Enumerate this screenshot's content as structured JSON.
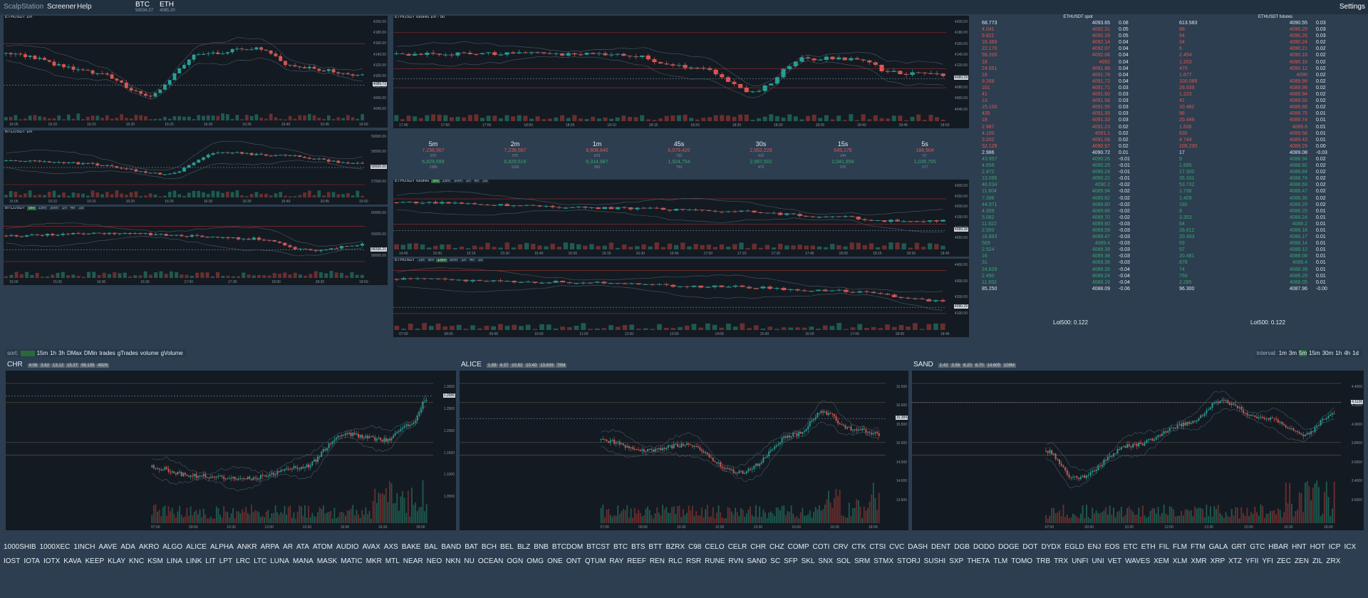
{
  "app": {
    "brand": "ScalpStation",
    "menu": [
      "Screener",
      "Help"
    ],
    "settings": "Settings"
  },
  "tickers": [
    {
      "sym": "BTC",
      "price": "58534.37"
    },
    {
      "sym": "ETH",
      "price": "4085.20"
    }
  ],
  "charts": {
    "btc1m": {
      "title": "ETHUSDT 1m",
      "y": [
        "4200.00",
        "4180.00",
        "4160.00",
        "4140.00",
        "4120.00",
        "4100.00",
        "4080.00",
        "4060.00",
        "4040.00"
      ],
      "x": [
        "16:05",
        "16:10",
        "16:15",
        "16:20",
        "16:25",
        "16:30",
        "16:35",
        "16:40",
        "16:45",
        "16:50"
      ],
      "curr": "4089.73"
    },
    "btc1m2": {
      "title": "BTCUSDT 1m",
      "y": [
        "59000.00",
        "58500.00",
        "58000.00",
        "57500.00"
      ],
      "x": [
        "16:05",
        "16:10",
        "16:15",
        "16:20",
        "16:25",
        "16:30",
        "16:35",
        "16:40",
        "16:45",
        "16:50"
      ],
      "curr": "58500.00"
    },
    "btc5m": {
      "title": "BTCUSDT",
      "buttons": [
        "5m",
        "15m",
        "30m",
        "1h",
        "4h",
        "1d"
      ],
      "active": "5m",
      "y": [
        "60000.00",
        "59000.00",
        "58000.00"
      ],
      "x": [
        "15:00",
        "15:30",
        "16:00",
        "16:30",
        "17:00",
        "17:30",
        "18:00",
        "18:30",
        "18:50"
      ],
      "curr": "58336.21"
    },
    "ethfut1m": {
      "title": "ETHUSDT futures 1m - 50",
      "y": [
        "4200.00",
        "4180.00",
        "4160.00",
        "4140.00",
        "4120.00",
        "4100.00",
        "4080.00",
        "4060.00",
        "4040.00"
      ],
      "x": [
        "17:45",
        "17:50",
        "17:55",
        "18:00",
        "18:05",
        "18:10",
        "18:15",
        "18:20",
        "18:25",
        "18:30",
        "18:35",
        "18:40",
        "18:45",
        "18:50"
      ],
      "curr": "4089.29"
    },
    "ethfut5m": {
      "title": "ETHUSDT futures",
      "buttons": [
        "5m",
        "15m",
        "30m",
        "1h",
        "4h",
        "1d"
      ],
      "active": "5m",
      "y": [
        "4300.00",
        "4250.00",
        "4200.00",
        "4150.00",
        "4100.00",
        "4050.00"
      ],
      "x": [
        "14:45",
        "15:00",
        "15:15",
        "15:30",
        "15:45",
        "16:00",
        "16:15",
        "16:30",
        "16:45",
        "17:00",
        "17:15",
        "17:30",
        "17:45",
        "18:00",
        "18:15",
        "18:30",
        "18:45"
      ],
      "curr": "4089.28"
    },
    "eth1h": {
      "title": "ETHUSDT",
      "buttons": [
        "1m",
        "5m",
        "15m",
        "30m",
        "1h",
        "4h",
        "1d"
      ],
      "active": "15m",
      "y": [
        "4400.00",
        "4300.00",
        "4200.00",
        "4100.00"
      ],
      "x": [
        "07:00",
        "08:00",
        "09:00",
        "10:00",
        "11:00",
        "12:00",
        "13:00",
        "14:00",
        "15:00",
        "16:00",
        "17:00",
        "18:00",
        "18:45"
      ],
      "curr": "4090.29"
    }
  },
  "timeframes": [
    {
      "h": "5m",
      "r": "7,238,567",
      "s1": "975",
      "g": "6,829,599",
      "s2": "1385"
    },
    {
      "h": "2m",
      "r": "7,238,567",
      "s1": "975",
      "g": "6,829,516",
      "s2": "1100"
    },
    {
      "h": "1m",
      "r": "8,608,840",
      "s1": "879",
      "g": "6,314,987",
      "s2": "583"
    },
    {
      "h": "45s",
      "r": "6,079,420",
      "s1": "720",
      "g": "1,924,754",
      "s2": "753"
    },
    {
      "h": "30s",
      "r": "2,552,228",
      "s1": "410",
      "g": "2,987,502",
      "s2": "475"
    },
    {
      "h": "15s",
      "r": "545,176",
      "s1": "144",
      "g": "2,041,858",
      "s2": "375"
    },
    {
      "h": "5s",
      "r": "188,904",
      "s1": "57",
      "g": "1,039,755",
      "s2": "177"
    }
  ],
  "orderbook": {
    "spot_title": "ETHUSDT spot",
    "fut_title": "ETHUSDT futures",
    "rows": [
      [
        "68.773",
        "4093.65",
        "0.08",
        "613.583",
        "4090.55",
        "0.03",
        "w"
      ],
      [
        "4.041",
        "4092.31",
        "0.05",
        "88",
        "4090.29",
        "0.03",
        "r"
      ],
      [
        "9.821",
        "4092.19",
        "0.05",
        "94",
        "4090.26",
        "0.03",
        "r"
      ],
      [
        "16.369",
        "4092.14",
        "0.04",
        "34",
        "4090.24",
        "0.02",
        "r"
      ],
      [
        "22.170",
        "4092.07",
        "0.04",
        "6",
        "4090.21",
        "0.02",
        "r"
      ],
      [
        "59.205",
        "4092.06",
        "0.04",
        "2.454",
        "4090.18",
        "0.02",
        "r"
      ],
      [
        "18",
        "4092",
        "0.04",
        "1.203",
        "4090.16",
        "0.02",
        "r"
      ],
      [
        "24.551",
        "4091.88",
        "0.04",
        "470",
        "4090.12",
        "0.02",
        "r"
      ],
      [
        "18",
        "4091.78",
        "0.04",
        "1.677",
        "4090",
        "0.02",
        "r"
      ],
      [
        "9.268",
        "4091.72",
        "0.04",
        "100.089",
        "4089.99",
        "0.02",
        "r"
      ],
      [
        "101",
        "4091.71",
        "0.03",
        "29.939",
        "4089.98",
        "0.02",
        "r"
      ],
      [
        "41",
        "4091.60",
        "0.03",
        "1.223",
        "4089.94",
        "0.02",
        "r"
      ],
      [
        "13",
        "4091.58",
        "0.03",
        "41",
        "4089.92",
        "0.02",
        "r"
      ],
      [
        "15.100",
        "4091.55",
        "0.03",
        "10.482",
        "4089.88",
        "0.02",
        "r"
      ],
      [
        "435",
        "4091.35",
        "0.03",
        "96",
        "4089.75",
        "0.01",
        "r"
      ],
      [
        "18",
        "4091.33",
        "0.03",
        "20.449",
        "4089.74",
        "0.01",
        "r"
      ],
      [
        "2.987",
        "4091.23",
        "0.02",
        "1.636",
        "4089.6",
        "0.01",
        "r"
      ],
      [
        "4.100",
        "4091.1",
        "0.02",
        "630",
        "4089.58",
        "0.01",
        "r"
      ],
      [
        "3.202",
        "4091.08",
        "0.02",
        "4.744",
        "4089.43",
        "0.01",
        "r"
      ],
      [
        "32.128",
        "4090.97",
        "0.02",
        "105.230",
        "4089.29",
        "0.00",
        "r"
      ],
      [
        "2.986",
        "4090.72",
        "0.01",
        "17",
        "4089.08",
        "-0.03",
        "w"
      ],
      [
        "43.957",
        "4090.26",
        "-0.01",
        "9",
        "4088.94",
        "0.02",
        "g"
      ],
      [
        "4.658",
        "4090.25",
        "-0.01",
        "1.895",
        "4088.92",
        "0.02",
        "g"
      ],
      [
        "2.472",
        "4090.24",
        "-0.01",
        "17.300",
        "4088.84",
        "0.02",
        "g"
      ],
      [
        "13.085",
        "4090.22",
        "-0.01",
        "35.331",
        "4088.74",
        "0.02",
        "g"
      ],
      [
        "46.034",
        "4090.2",
        "-0.02",
        "53.732",
        "4088.69",
        "0.02",
        "g"
      ],
      [
        "11.604",
        "4089.94",
        "-0.02",
        "1.736",
        "4088.47",
        "0.02",
        "g"
      ],
      [
        "7.396",
        "4089.82",
        "-0.02",
        "1.409",
        "4088.36",
        "0.02",
        "g"
      ],
      [
        "44.971",
        "4089.80",
        "-0.02",
        "180",
        "4088.29",
        "0.02",
        "g"
      ],
      [
        "4.309",
        "4089.68",
        "-0.02",
        "8",
        "4088.25",
        "0.01",
        "g"
      ],
      [
        "5.082",
        "4089.70",
        "-0.02",
        "3.353",
        "4088.24",
        "0.01",
        "g"
      ],
      [
        "11.822",
        "4089.60",
        "-0.03",
        "64",
        "4088.2",
        "0.01",
        "g"
      ],
      [
        "2.500",
        "4089.59",
        "-0.03",
        "26.612",
        "4088.18",
        "0.01",
        "g"
      ],
      [
        "16.893",
        "4089.47",
        "-0.03",
        "20.493",
        "4088.17",
        "0.01",
        "g"
      ],
      [
        "569",
        "4089.4",
        "-0.03",
        "59",
        "4088.14",
        "0.01",
        "g"
      ],
      [
        "2.524",
        "4089.39",
        "-0.03",
        "57",
        "4088.12",
        "0.01",
        "g"
      ],
      [
        "16",
        "4089.38",
        "-0.03",
        "20.481",
        "4088.08",
        "0.01",
        "g"
      ],
      [
        "31",
        "4089.36",
        "-0.03",
        "878",
        "4088.4",
        "0.01",
        "g"
      ],
      [
        "24.828",
        "4089.26",
        "-0.04",
        "74",
        "4088.39",
        "0.01",
        "g"
      ],
      [
        "2.490",
        "4089.24",
        "-0.04",
        "760",
        "4088.29",
        "0.01",
        "g"
      ],
      [
        "11.652",
        "4088.19",
        "-0.04",
        "2.285",
        "4088.05",
        "0.01",
        "g"
      ],
      [
        "85.250",
        "4088.09",
        "-0.06",
        "96.300",
        "4087.96",
        "-0.00",
        "w"
      ]
    ],
    "lot_spot": "Lot500: 0.122",
    "lot_fut": "Lot500: 0.122"
  },
  "sort": {
    "label": "sort:",
    "items": [
      "15m",
      "1h",
      "3h",
      "DMax",
      "DMin",
      "trades",
      "gTrades",
      "volume",
      "gVolume"
    ]
  },
  "interval": {
    "label": "interval:",
    "items": [
      "1m",
      "3m",
      "5m",
      "15m",
      "30m",
      "1h",
      "4h",
      "1d"
    ],
    "active": "5m"
  },
  "bigcharts": [
    {
      "sym": "CHR",
      "chips": [
        "4.06",
        "3.62",
        "13.12",
        "15.37",
        "99.135",
        "482K"
      ],
      "y": [
        "1.3000",
        "1.2500",
        "1.2000",
        "1.1500",
        "1.1000",
        "1.0500"
      ],
      "x": [
        "07:00",
        "09:00",
        "10:30",
        "12:00",
        "13:30",
        "15:00",
        "16:30",
        "18:00"
      ],
      "curr": "1.2686"
    },
    {
      "sym": "ALICE",
      "chips": [
        "1.89",
        "4.37",
        "10.82",
        "10.40",
        "13.639",
        "78M"
      ],
      "y": [
        "16.500",
        "16.000",
        "15.500",
        "15.000",
        "14.500",
        "14.000",
        "13.500"
      ],
      "x": [
        "07:00",
        "09:00",
        "10:30",
        "12:00",
        "13:30",
        "15:00",
        "16:30",
        "18:00"
      ],
      "curr": "15.384"
    },
    {
      "sym": "SAND",
      "chips": [
        "1.42",
        "3.56",
        "6.20",
        "6.70",
        "14.605",
        "109M"
      ],
      "y": [
        "4.4000",
        "4.2000",
        "4.0000",
        "3.8000",
        "3.6000",
        "3.4000",
        "3.6000"
      ],
      "x": [
        "07:00",
        "09:00",
        "10:30",
        "12:00",
        "13:30",
        "15:00",
        "16:30",
        "18:00"
      ],
      "curr": "4.1126"
    }
  ],
  "symbols": [
    "1000SHIB",
    "1000XEC",
    "1INCH",
    "AAVE",
    "ADA",
    "AKRO",
    "ALGO",
    "ALICE",
    "ALPHA",
    "ANKR",
    "ARPA",
    "AR",
    "ATA",
    "ATOM",
    "AUDIO",
    "AVAX",
    "AXS",
    "BAKE",
    "BAL",
    "BAND",
    "BAT",
    "BCH",
    "BEL",
    "BLZ",
    "BNB",
    "BTCDOM",
    "BTCST",
    "BTC",
    "BTS",
    "BTT",
    "BZRX",
    "C98",
    "CELO",
    "CELR",
    "CHR",
    "CHZ",
    "COMP",
    "COTI",
    "CRV",
    "CTK",
    "CTSI",
    "CVC",
    "DASH",
    "DENT",
    "DGB",
    "DODO",
    "DOGE",
    "DOT",
    "DYDX",
    "EGLD",
    "ENJ",
    "EOS",
    "ETC",
    "ETH",
    "FIL",
    "FLM",
    "FTM",
    "GALA",
    "GRT",
    "GTC",
    "HBAR",
    "HNT",
    "HOT",
    "ICP",
    "ICX",
    "IOST",
    "IOTA",
    "IOTX",
    "KAVA",
    "KEEP",
    "KLAY",
    "KNC",
    "KSM",
    "LINA",
    "LINK",
    "LIT",
    "LPT",
    "LRC",
    "LTC",
    "LUNA",
    "MANA",
    "MASK",
    "MATIC",
    "MKR",
    "MTL",
    "NEAR",
    "NEO",
    "NKN",
    "NU",
    "OCEAN",
    "OGN",
    "OMG",
    "ONE",
    "ONT",
    "QTUM",
    "RAY",
    "REEF",
    "REN",
    "RLC",
    "RSR",
    "RUNE",
    "RVN",
    "SAND",
    "SC",
    "SFP",
    "SKL",
    "SNX",
    "SOL",
    "SRM",
    "STMX",
    "STORJ",
    "SUSHI",
    "SXP",
    "THETA",
    "TLM",
    "TOMO",
    "TRB",
    "TRX",
    "UNFI",
    "UNI",
    "VET",
    "WAVES",
    "XEM",
    "XLM",
    "XMR",
    "XRP",
    "XTZ",
    "YFII",
    "YFI",
    "ZEC",
    "ZEN",
    "ZIL",
    "ZRX"
  ],
  "colors": {
    "up": "#26a69a",
    "down": "#ef5350",
    "bg": "#131a22",
    "page": "#2c3e50"
  }
}
